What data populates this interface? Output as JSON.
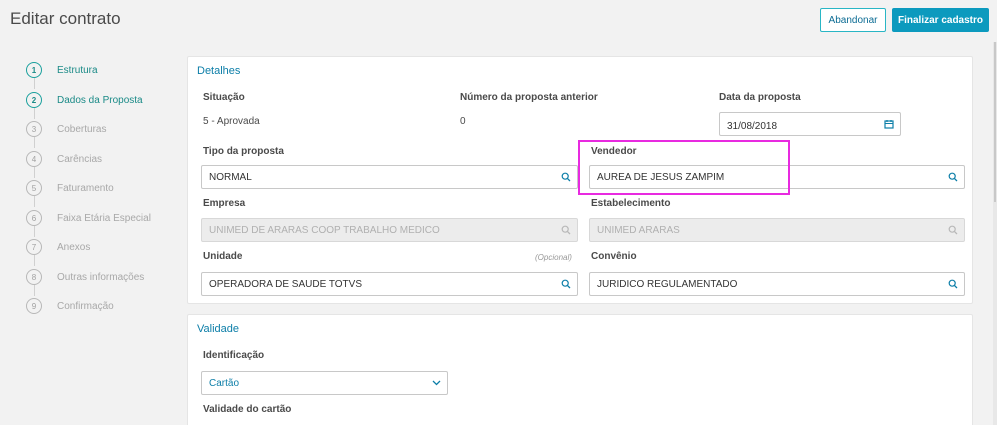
{
  "header": {
    "title": "Editar contrato",
    "abandon_label": "Abandonar",
    "finish_label": "Finalizar cadastro"
  },
  "steps": [
    {
      "num": "1",
      "label": "Estrutura",
      "active": true
    },
    {
      "num": "2",
      "label": "Dados da Proposta",
      "active": true
    },
    {
      "num": "3",
      "label": "Coberturas",
      "active": false
    },
    {
      "num": "4",
      "label": "Carências",
      "active": false
    },
    {
      "num": "5",
      "label": "Faturamento",
      "active": false
    },
    {
      "num": "6",
      "label": "Faixa Etária Especial",
      "active": false
    },
    {
      "num": "7",
      "label": "Anexos",
      "active": false
    },
    {
      "num": "8",
      "label": "Outras informações",
      "active": false
    },
    {
      "num": "9",
      "label": "Confirmação",
      "active": false
    }
  ],
  "details": {
    "title": "Detalhes",
    "situacao_label": "Situação",
    "situacao_value": "5 - Aprovada",
    "numero_label": "Número da proposta anterior",
    "numero_value": "0",
    "data_label": "Data da proposta",
    "data_value": "31/08/2018",
    "tipo_label": "Tipo da proposta",
    "tipo_value": "NORMAL",
    "vendedor_label": "Vendedor",
    "vendedor_value": "AUREA DE JESUS ZAMPIM",
    "empresa_label": "Empresa",
    "empresa_value": "UNIMED DE ARARAS COOP TRABALHO MEDICO",
    "estabelecimento_label": "Estabelecimento",
    "estabelecimento_value": "UNIMED ARARAS",
    "unidade_label": "Unidade",
    "unidade_optional": "(Opcional)",
    "unidade_value": "OPERADORA DE SAUDE TOTVS",
    "convenio_label": "Convênio",
    "convenio_value": "JURIDICO REGULAMENTADO"
  },
  "validity": {
    "title": "Validade",
    "identificacao_label": "Identificação",
    "identificacao_value": "Cartão",
    "validade_cartao_label": "Validade do cartão"
  },
  "colors": {
    "accent": "#0c9abe",
    "step_active": "#1a8a87",
    "highlight": "#e82ae0"
  }
}
